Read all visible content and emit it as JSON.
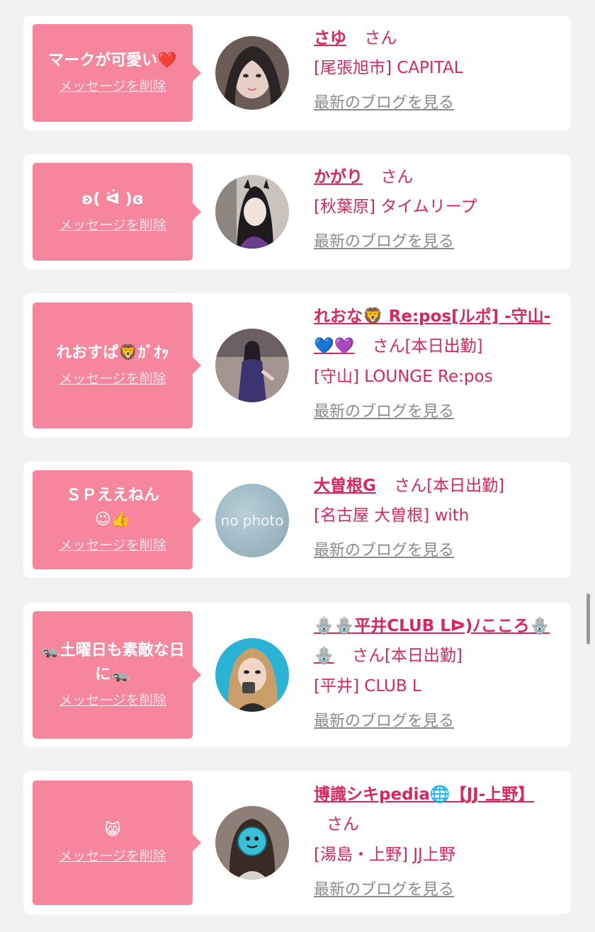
{
  "cards": [
    {
      "message": "マークが可愛い❤️",
      "delete_label": "メッセージを削除",
      "name": "さゆ",
      "san": "さん",
      "shop": "[尾張旭市] CAPITAL",
      "blog_label": "最新のブログを見る"
    },
    {
      "message": "ʚ( ᐛ )ɞ",
      "delete_label": "メッセージを削除",
      "name": "かがり",
      "san": "さん",
      "shop": "[秋葉原] タイムリープ",
      "blog_label": "最新のブログを見る"
    },
    {
      "message": "れおすぱ🦁ｶﾞｵｯ",
      "delete_label": "メッセージを削除",
      "name": "れおな🦁 Re:pos[ルポ] -守山-💙💜",
      "san": "さん[本日出勤]",
      "shop": "[守山] LOUNGE Re:pos",
      "blog_label": "最新のブログを見る"
    },
    {
      "message": "ＳＰええねん😉👍",
      "delete_label": "メッセージを削除",
      "name": "大曽根G",
      "san": "さん[本日出勤]",
      "shop": "[名古屋 大曽根] with",
      "blog_label": "最新のブログを見る",
      "avatar_text": "no photo"
    },
    {
      "message": "🦡土曜日も素敵な日に🦡",
      "delete_label": "メッセージを削除",
      "name": "🪬🪬平井CLUB Lᐅ)ﾉこころ🪬🪬",
      "san": "さん[本日出勤]",
      "shop": "[平井] CLUB L",
      "blog_label": "最新のブログを見る"
    },
    {
      "message": "😸",
      "delete_label": "メッセージを削除",
      "name": "博識シキpedia🌐【JJ-上野】",
      "san": "さん",
      "shop": "[湯島・上野] JJ上野",
      "blog_label": "最新のブログを見る"
    }
  ]
}
